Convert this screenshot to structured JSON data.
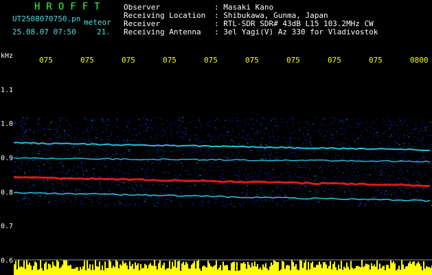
{
  "header": {
    "title": "HROFFT",
    "filename": "UT2508070750.pn",
    "tag": "meteor",
    "datetime": "25.08.07 07:50",
    "value": "21."
  },
  "info": {
    "labels": [
      "Observer",
      "Receiving Location",
      "Receiver",
      "Receiving Antenna"
    ],
    "values": [
      ": Masaki Kano",
      ": Shibukawa, Gunma, Japan",
      ": RTL-SDR SDR# 43dB L15 103.2MHz CW",
      ": 3el Yagi(V) Az 330 for Vladivostok"
    ]
  },
  "axis": {
    "unit": "kHz",
    "y_labels": [
      "1.1",
      "1.0",
      "0.9",
      "0.8",
      "0.7",
      "0.6"
    ],
    "x_labels": [
      "075",
      "075",
      "075",
      "075",
      "075",
      "075",
      "075",
      "075",
      "075",
      "0800"
    ]
  },
  "colors": {
    "background": "#000000",
    "noise": "#1a3cff",
    "signal_strong": "#ff2020",
    "signal_mid": "#30e0ff",
    "amplitude": "#ffff00",
    "grid": "#ffffff"
  }
}
